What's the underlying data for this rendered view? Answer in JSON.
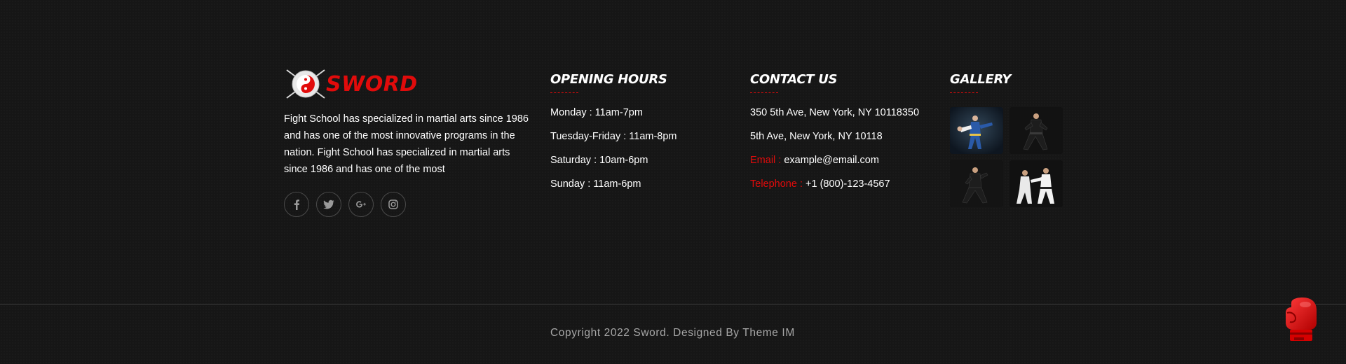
{
  "brand": {
    "name": "SWORD"
  },
  "about": {
    "text": "Fight School has specialized in martial arts since 1986 and has one of the most innovative programs in the nation. Fight School has specialized in martial arts since 1986 and has one of the most"
  },
  "socials": [
    {
      "icon": "facebook-icon",
      "glyph": "f"
    },
    {
      "icon": "twitter-icon",
      "glyph": "t"
    },
    {
      "icon": "google-plus-icon",
      "glyph": "G+"
    },
    {
      "icon": "instagram-icon",
      "glyph": "ig"
    }
  ],
  "hours": {
    "title": "OPENING HOURS",
    "items": [
      "Monday : 11am-7pm",
      "Tuesday-Friday : 11am-8pm",
      "Saturday : 10am-6pm",
      "Sunday : 11am-6pm"
    ]
  },
  "contact": {
    "title": "CONTACT US",
    "address1": "350 5th Ave, New York, NY 10118350",
    "address2": "5th Ave, New York, NY 10118",
    "email_label": "Email : ",
    "email": "example@email.com",
    "phone_label": "Telephone : ",
    "phone": "+1 (800)-123-4567"
  },
  "gallery": {
    "title": "GALLERY",
    "images": [
      "karate-kick-photo",
      "martial-artist-stance-photo",
      "martial-artist-fighting-photo",
      "karate-sparring-photo"
    ]
  },
  "footer": {
    "copyright": "Copyright 2022 Sword. Designed By Theme IM"
  },
  "colors": {
    "accent": "#e10b0b",
    "background": "#161616",
    "text": "#ffffff",
    "muted": "#a7a7a7"
  }
}
